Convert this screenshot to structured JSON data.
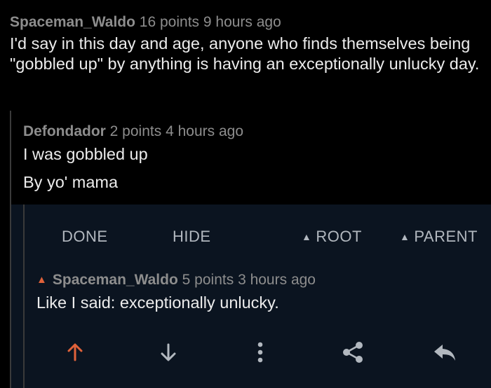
{
  "colors": {
    "background": "#000000",
    "selected_background": "#0b1420",
    "upvote_accent": "#e0623a",
    "icon": "#b2b8bf"
  },
  "comments": [
    {
      "author": "Spaceman_Waldo",
      "points": "16 points",
      "age": "9 hours ago",
      "body": "I'd say in this day and age, anyone who finds themselves being \"gobbled up\" by anything is having an exceptionally unlucky day."
    },
    {
      "author": "Defondador",
      "points": "2 points",
      "age": "4 hours ago",
      "body_lines": [
        "I was gobbled up",
        "By yo' mama"
      ]
    },
    {
      "author": "Spaceman_Waldo",
      "points": "5 points",
      "age": "3 hours ago",
      "upvoted": true,
      "body": "Like I said: exceptionally unlucky."
    }
  ],
  "toolbar": {
    "done": "DONE",
    "hide": "HIDE",
    "root": "ROOT",
    "parent": "PARENT"
  },
  "bottom_bar": [
    "upvote-icon",
    "downvote-icon",
    "more-vertical-icon",
    "share-icon",
    "reply-icon"
  ]
}
